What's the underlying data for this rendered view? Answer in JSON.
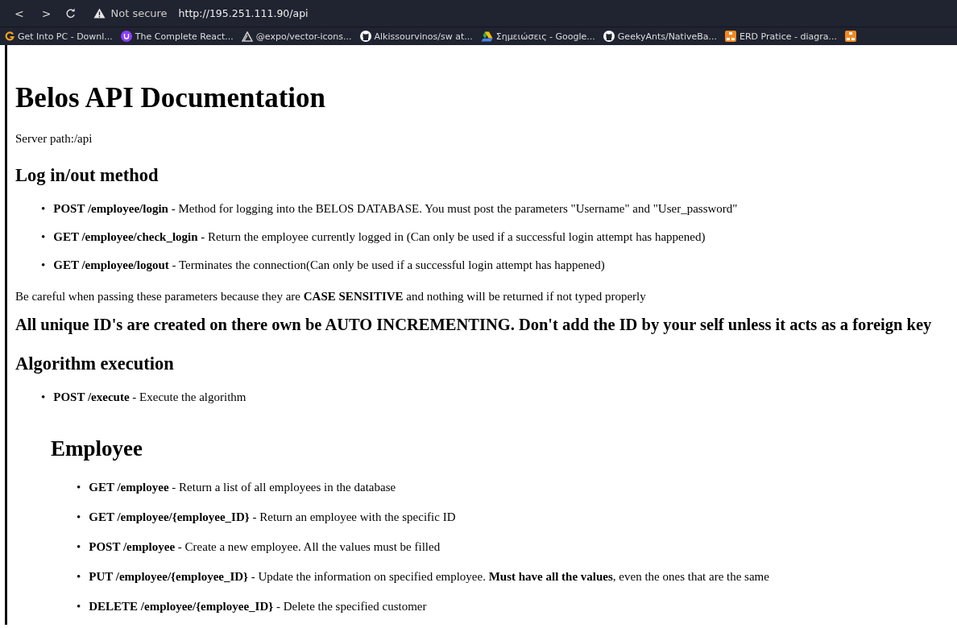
{
  "browser": {
    "nav_buttons": [
      "<",
      ">"
    ],
    "security": "Not secure",
    "url": "http://195.251.111.90/api",
    "bookmarks": [
      {
        "label": "Get Into PC - Downl...",
        "kind": "g",
        "color": "#f0a020"
      },
      {
        "label": "The Complete React...",
        "kind": "circle",
        "color": "#8a3ffc"
      },
      {
        "label": "@expo/vector-icons...",
        "kind": "expo",
        "color": "#c8c8c8"
      },
      {
        "label": "Alkissourvinos/sw at...",
        "kind": "github",
        "color": "#ffffff"
      },
      {
        "label": "Σημειώσεις - Google...",
        "kind": "drive",
        "color": "#34a853"
      },
      {
        "label": "GeekyAnts/NativeBa...",
        "kind": "github",
        "color": "#ffffff"
      },
      {
        "label": "ERD Pratice - diagra...",
        "kind": "square",
        "color": "#f08a24"
      },
      {
        "kind": "square",
        "color": "#f08a24"
      }
    ]
  },
  "page": {
    "title": "Belos API Documentation",
    "server_path": "Server path:/api",
    "sections": [
      {
        "kind": "h2",
        "text": "Log in/out method"
      },
      {
        "kind": "list",
        "items": [
          {
            "marker": "•",
            "method": "POST /employee/login",
            "description": "- Method for logging into the BELOS DATABASE. You must post the parameters \"Username\" and \"User_password\""
          },
          {
            "marker": "•",
            "method": "GET /employee/check_login",
            "description": "- Return the employee currently logged in (Can only be used if a successful login attempt has happened)"
          },
          {
            "marker": "•",
            "method": "GET /employee/logout",
            "description": "- Terminates the connection(Can only be used if a successful login attempt has happened)"
          }
        ]
      },
      {
        "kind": "note",
        "text": "Be careful when passing these parameters because they are **CASE SENSITIVE** and nothing will be returned if not typed properly"
      },
      {
        "kind": "warning",
        "text": "All unique ID's are created on there own be AUTO INCREMENTING. Don't add the ID by your self unless it acts as a foreign key"
      },
      {
        "kind": "h2",
        "text": "Algorithm execution"
      },
      {
        "kind": "list",
        "items": [
          {
            "marker": "•",
            "method": "POST /execute",
            "description": "- Execute the algorithm"
          }
        ]
      },
      {
        "kind": "subsection",
        "title": "Employee",
        "items": [
          {
            "marker": "•",
            "method": "GET /employee",
            "description": "- Return a list of all employees in the database"
          },
          {
            "marker": "•",
            "method": "GET /employee/{employee_ID}",
            "description": "- Return an employee with the specific ID"
          },
          {
            "marker": "•",
            "method": "POST /employee",
            "description": "- Create a new employee. All the values must be filled"
          },
          {
            "marker": "•",
            "method": "PUT /employee/{employee_ID}",
            "description": "- Update the information on specified employee. **Must have all the values**, even the ones that are the same"
          },
          {
            "marker": "•",
            "method": "DELETE /employee/{employee_ID}",
            "description": "- Delete the specified customer"
          }
        ]
      }
    ]
  }
}
